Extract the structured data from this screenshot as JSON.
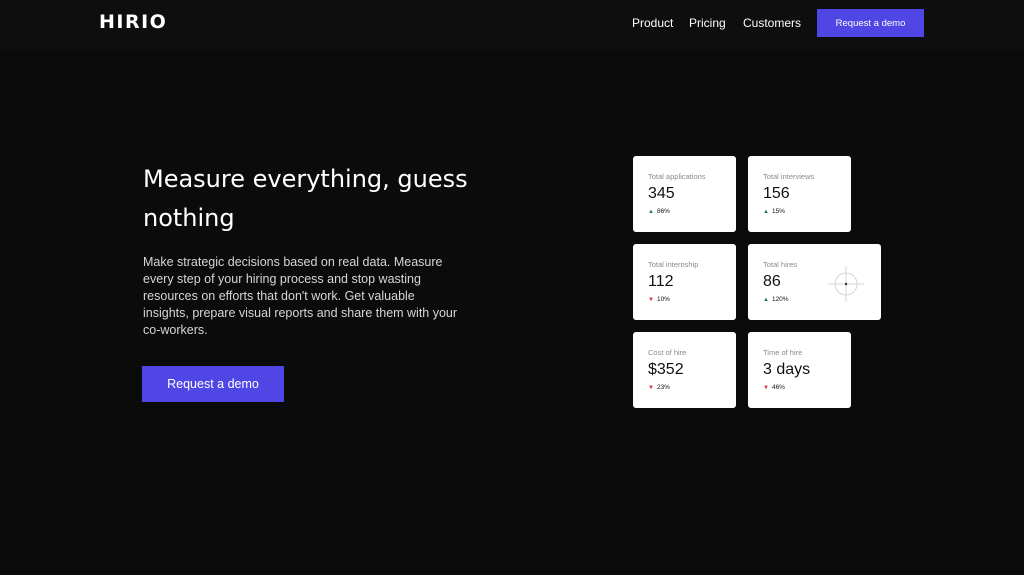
{
  "header": {
    "logo": "HIRIO",
    "nav": [
      "Product",
      "Pricing",
      "Customers"
    ],
    "cta": "Request a demo"
  },
  "hero": {
    "title": "Measure everything, guess nothing",
    "body": "Make strategic decisions based on real data. Measure every step of your hiring process and stop wasting resources on efforts that don't work. Get valuable insights, prepare visual reports and share them with your co-workers.",
    "cta": "Request a demo"
  },
  "stats": [
    {
      "label": "Total applications",
      "value": "345",
      "change": "86%",
      "direction": "up"
    },
    {
      "label": "Total interviews",
      "value": "156",
      "change": "15%",
      "direction": "up"
    },
    {
      "label": "Total internship",
      "value": "112",
      "change": "10%",
      "direction": "down"
    },
    {
      "label": "Total hires",
      "value": "86",
      "change": "120%",
      "direction": "up",
      "icon": "crosshair-icon"
    },
    {
      "label": "Cost of hire",
      "value": "$352",
      "change": "23%",
      "direction": "down"
    },
    {
      "label": "Time of hire",
      "value": "3 days",
      "change": "46%",
      "direction": "down"
    }
  ],
  "colors": {
    "background": "#0b0b0c",
    "accent": "#4f46e5",
    "up": "#1f7a6b",
    "down": "#d92b3a"
  }
}
